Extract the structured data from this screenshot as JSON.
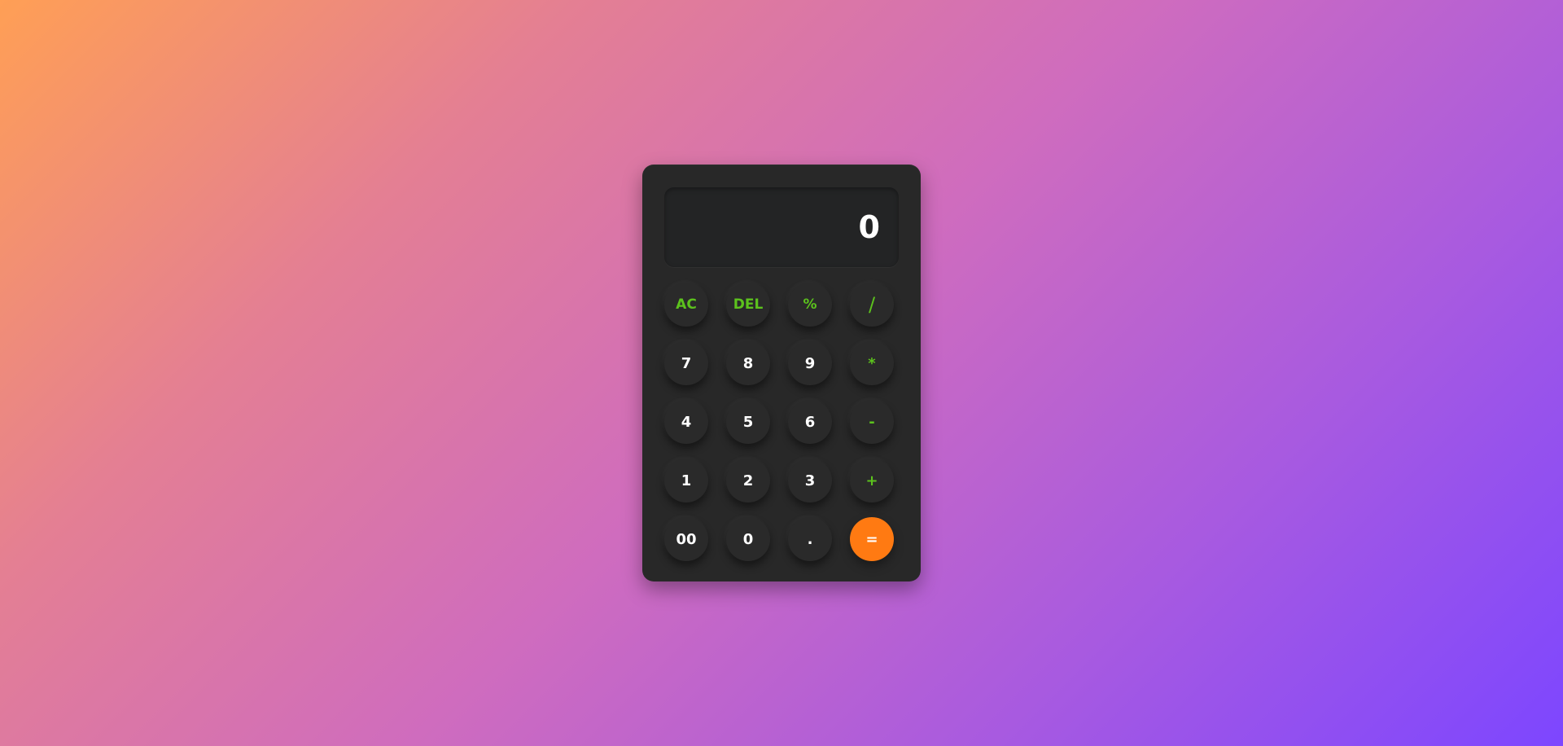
{
  "display": {
    "value": "0"
  },
  "keys": [
    {
      "label": "AC",
      "kind": "func",
      "name": "clear-button"
    },
    {
      "label": "DEL",
      "kind": "func",
      "name": "delete-button"
    },
    {
      "label": "%",
      "kind": "func",
      "name": "percent-button"
    },
    {
      "label": "/",
      "kind": "op",
      "name": "divide-button"
    },
    {
      "label": "7",
      "kind": "num",
      "name": "digit-7-button"
    },
    {
      "label": "8",
      "kind": "num",
      "name": "digit-8-button"
    },
    {
      "label": "9",
      "kind": "num",
      "name": "digit-9-button"
    },
    {
      "label": "*",
      "kind": "op",
      "name": "multiply-button"
    },
    {
      "label": "4",
      "kind": "num",
      "name": "digit-4-button"
    },
    {
      "label": "5",
      "kind": "num",
      "name": "digit-5-button"
    },
    {
      "label": "6",
      "kind": "num",
      "name": "digit-6-button"
    },
    {
      "label": "-",
      "kind": "op",
      "name": "subtract-button"
    },
    {
      "label": "1",
      "kind": "num",
      "name": "digit-1-button"
    },
    {
      "label": "2",
      "kind": "num",
      "name": "digit-2-button"
    },
    {
      "label": "3",
      "kind": "num",
      "name": "digit-3-button"
    },
    {
      "label": "+",
      "kind": "op",
      "name": "add-button"
    },
    {
      "label": "00",
      "kind": "num",
      "name": "double-zero-button"
    },
    {
      "label": "0",
      "kind": "num",
      "name": "digit-0-button"
    },
    {
      "label": ".",
      "kind": "num",
      "name": "decimal-button"
    },
    {
      "label": "=",
      "kind": "equals",
      "name": "equals-button"
    }
  ],
  "colors": {
    "accent_green": "#5cc21d",
    "equals_orange": "#ff7a12",
    "body": "#282828",
    "display_bg": "#232425"
  }
}
